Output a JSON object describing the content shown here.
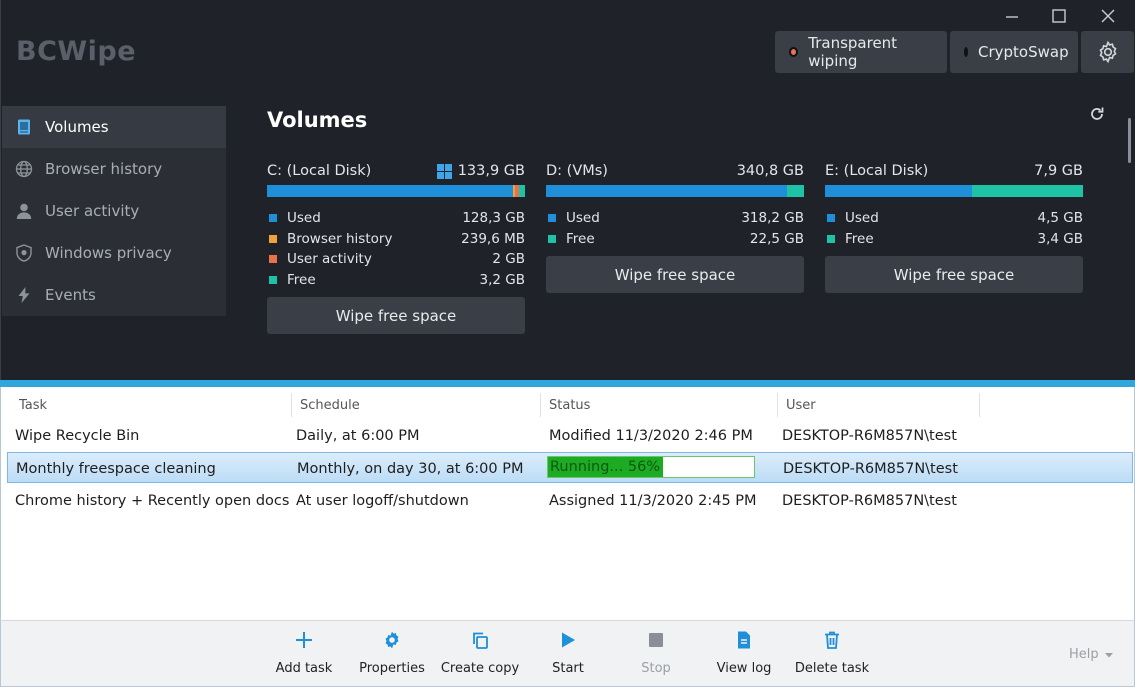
{
  "app": {
    "title": "BCWipe"
  },
  "window_controls": {
    "minimize": "—",
    "maximize": "☐",
    "close": "✕"
  },
  "top_buttons": {
    "transparent_wiping": {
      "label": "Transparent wiping",
      "dot_color": "#e8735a"
    },
    "cryptoswap": {
      "label": "CryptoSwap",
      "dot_color": "#22c2a5"
    }
  },
  "sidebar": {
    "items": [
      {
        "label": "Volumes",
        "icon": "volumes-icon",
        "active": true
      },
      {
        "label": "Browser history",
        "icon": "globe-icon",
        "active": false
      },
      {
        "label": "User activity",
        "icon": "user-icon",
        "active": false
      },
      {
        "label": "Windows privacy",
        "icon": "shield-icon",
        "active": false
      },
      {
        "label": "Events",
        "icon": "bolt-icon",
        "active": false
      }
    ]
  },
  "volumes": {
    "title": "Volumes",
    "disks": [
      {
        "name": "C: (Local Disk)",
        "size": "133,9 GB",
        "system": true,
        "segments": [
          {
            "label": "Used",
            "value": "128,3 GB",
            "color": "#1e8fd8",
            "gb": 128.3
          },
          {
            "label": "Browser history",
            "value": "239,6 MB",
            "color": "#f2a23a",
            "gb": 0.24
          },
          {
            "label": "User activity",
            "value": "2 GB",
            "color": "#e8734a",
            "gb": 2.0
          },
          {
            "label": "Free",
            "value": "3,2 GB",
            "color": "#1ec3a6",
            "gb": 3.2
          }
        ],
        "button": "Wipe free space"
      },
      {
        "name": "D: (VMs)",
        "size": "340,8 GB",
        "system": false,
        "segments": [
          {
            "label": "Used",
            "value": "318,2 GB",
            "color": "#1e8fd8",
            "gb": 318.2
          },
          {
            "label": "Free",
            "value": "22,5 GB",
            "color": "#1ec3a6",
            "gb": 22.5
          }
        ],
        "button": "Wipe free space"
      },
      {
        "name": "E: (Local Disk)",
        "size": "7,9 GB",
        "system": false,
        "segments": [
          {
            "label": "Used",
            "value": "4,5 GB",
            "color": "#1e8fd8",
            "gb": 4.5
          },
          {
            "label": "Free",
            "value": "3,4 GB",
            "color": "#1ec3a6",
            "gb": 3.4
          }
        ],
        "button": "Wipe free space"
      }
    ]
  },
  "tasks": {
    "columns": [
      "Task",
      "Schedule",
      "Status",
      "User"
    ],
    "rows": [
      {
        "task": "Wipe Recycle Bin",
        "schedule": "Daily, at 6:00 PM",
        "status": "Modified 11/3/2020 2:46 PM",
        "user": "DESKTOP-R6M857N\\test",
        "selected": false,
        "progress": null
      },
      {
        "task": "Monthly freespace cleaning",
        "schedule": "Monthly, on day 30, at 6:00 PM",
        "status": "Running... 56%",
        "user": "DESKTOP-R6M857N\\test",
        "selected": true,
        "progress": 0.56
      },
      {
        "task": "Chrome history + Recently open docs",
        "schedule": "At user logoff/shutdown",
        "status": "Assigned 11/3/2020 2:45 PM",
        "user": "DESKTOP-R6M857N\\test",
        "selected": false,
        "progress": null
      }
    ]
  },
  "toolbar": {
    "buttons": [
      {
        "label": "Add task",
        "icon": "plus-icon",
        "enabled": true
      },
      {
        "label": "Properties",
        "icon": "gear-icon",
        "enabled": true
      },
      {
        "label": "Create copy",
        "icon": "copy-icon",
        "enabled": true
      },
      {
        "label": "Start",
        "icon": "play-icon",
        "enabled": true
      },
      {
        "label": "Stop",
        "icon": "stop-icon",
        "enabled": false
      },
      {
        "label": "View log",
        "icon": "log-icon",
        "enabled": true
      },
      {
        "label": "Delete task",
        "icon": "trash-icon",
        "enabled": true
      }
    ],
    "help_label": "Help"
  },
  "colors": {
    "accent": "#31a6da",
    "icon_blue": "#1e8fd8"
  }
}
